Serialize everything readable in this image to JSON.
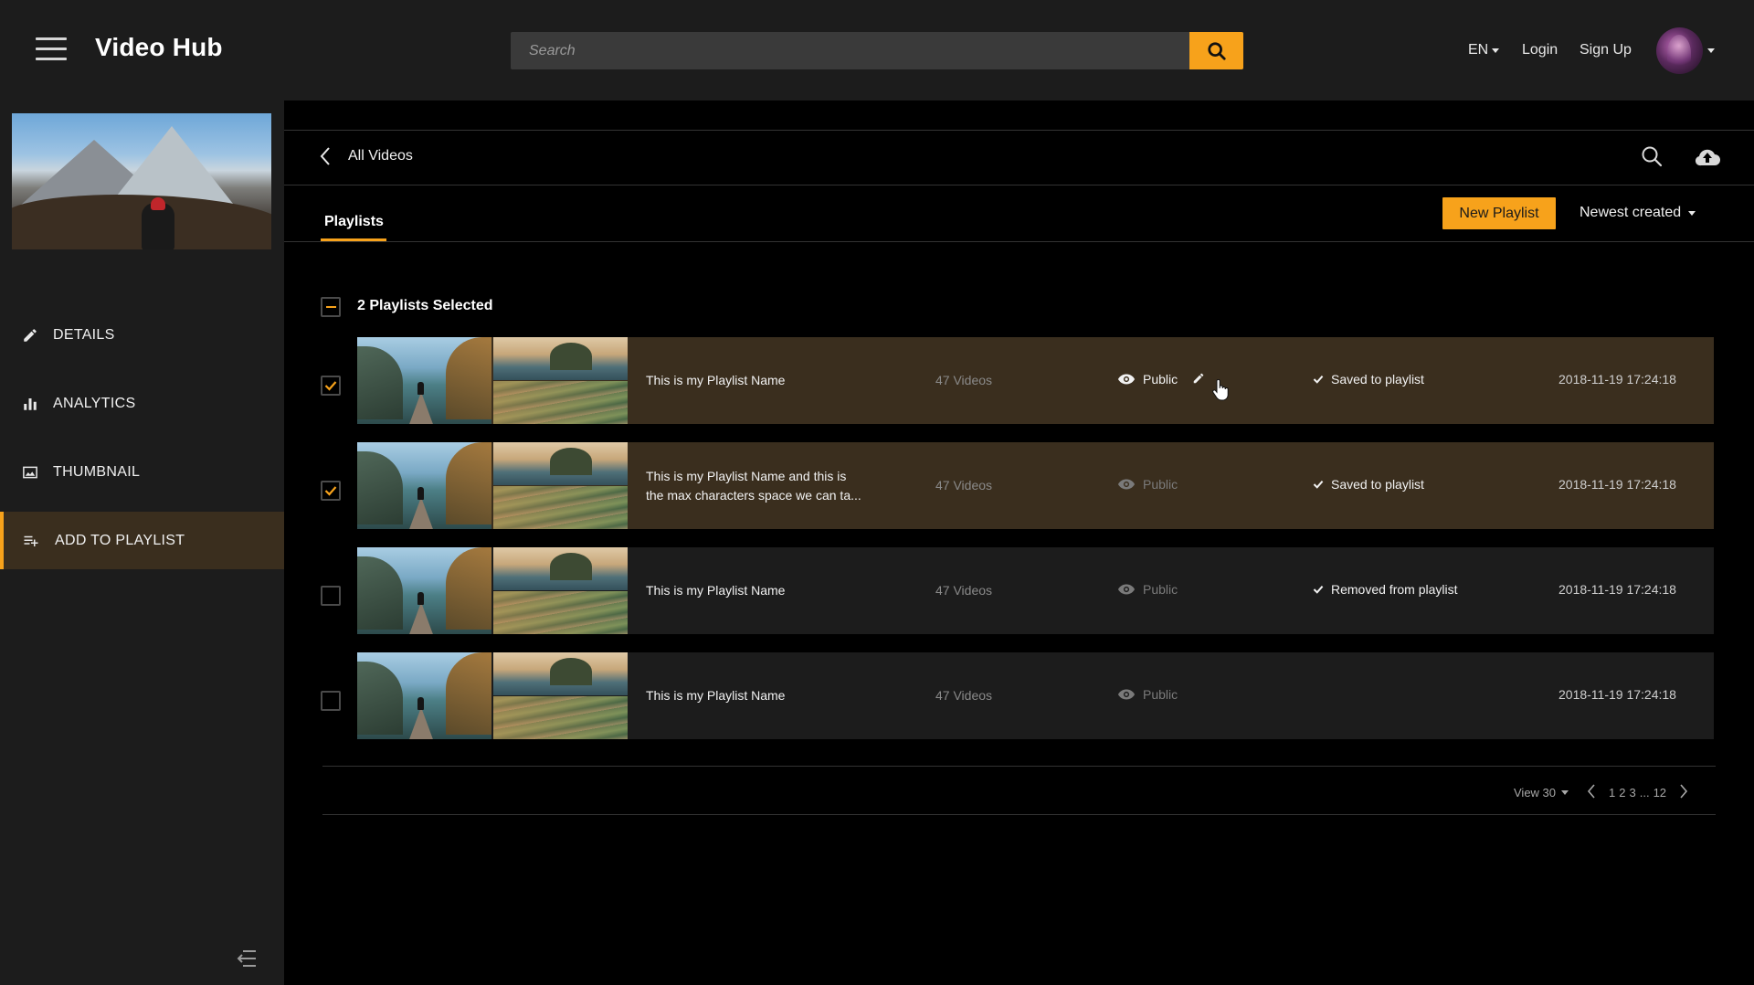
{
  "header": {
    "app_title": "Video Hub",
    "search_placeholder": "Search",
    "language": "EN",
    "login": "Login",
    "signup": "Sign Up"
  },
  "sidebar": {
    "items": [
      {
        "label": "DETAILS",
        "icon": "pencil-icon",
        "active": false
      },
      {
        "label": "ANALYTICS",
        "icon": "bar-chart-icon",
        "active": false
      },
      {
        "label": "THUMBNAIL",
        "icon": "image-icon",
        "active": false
      },
      {
        "label": "ADD TO PLAYLIST",
        "icon": "playlist-add-icon",
        "active": true
      }
    ]
  },
  "main": {
    "breadcrumb": "All Videos",
    "tab": "Playlists",
    "new_playlist": "New Playlist",
    "sort": "Newest created",
    "selected_text": "2 Playlists Selected",
    "playlists": [
      {
        "name_line1": "This is my Playlist Name",
        "name_line2": "",
        "videos": "47 Videos",
        "visibility": "Public",
        "status": "Saved to playlist",
        "date": "2018-11-19 17:24:18",
        "checked": true
      },
      {
        "name_line1": "This is my Playlist Name and this is",
        "name_line2": "the max characters space we can ta...",
        "videos": "47 Videos",
        "visibility": "Public",
        "status": "Saved to playlist",
        "date": "2018-11-19 17:24:18",
        "checked": true
      },
      {
        "name_line1": "This is my Playlist Name",
        "name_line2": "",
        "videos": "47 Videos",
        "visibility": "Public",
        "status": "Removed from playlist",
        "date": "2018-11-19 17:24:18",
        "checked": false
      },
      {
        "name_line1": "This is my Playlist Name",
        "name_line2": "",
        "videos": "47 Videos",
        "visibility": "Public",
        "status": "",
        "date": "2018-11-19 17:24:18",
        "checked": false
      }
    ],
    "pagination": {
      "view": "View 30",
      "pages": [
        "1",
        "2",
        "3",
        "...",
        "12"
      ]
    }
  },
  "colors": {
    "accent": "#f7a21b",
    "selected_row": "#3a2e1e",
    "row": "#1c1c1c",
    "panel": "#1c1c1c"
  }
}
